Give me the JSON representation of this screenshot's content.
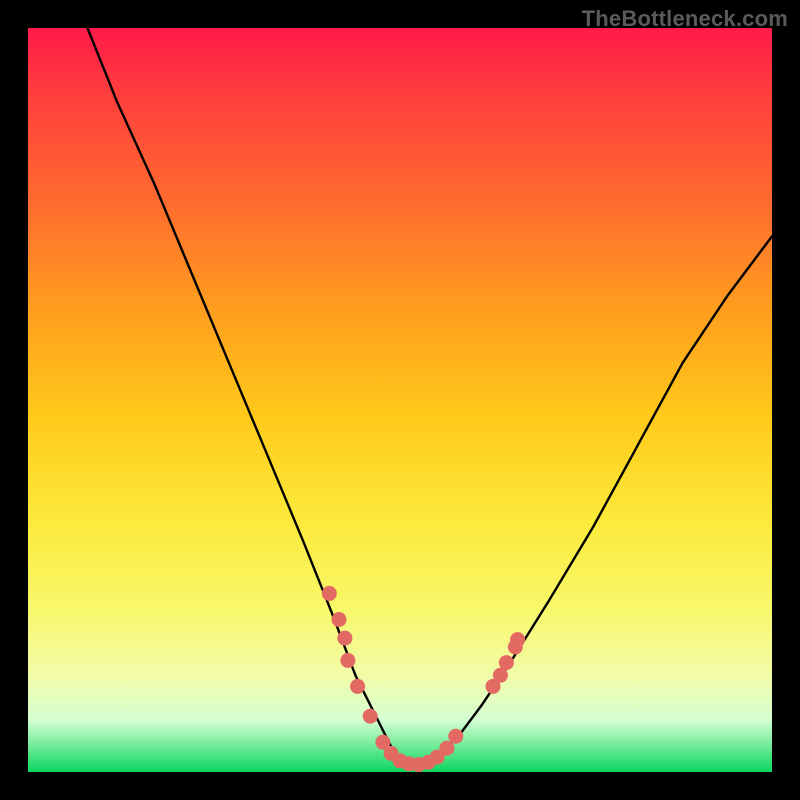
{
  "watermark": "TheBottleneck.com",
  "colors": {
    "frame_bg_top": "#ff1a4a",
    "frame_bg_bottom": "#0bd65f",
    "curve_stroke": "#000000",
    "marker_fill": "#e26a62",
    "page_bg": "#000000",
    "watermark_color": "#5a5a5a"
  },
  "chart_data": {
    "type": "line",
    "title": "",
    "xlabel": "",
    "ylabel": "",
    "xlim": [
      0,
      100
    ],
    "ylim": [
      0,
      100
    ],
    "grid": false,
    "legend": false,
    "series": [
      {
        "name": "curve",
        "x": [
          8,
          12,
          17,
          22,
          27,
          32,
          37,
          41,
          44,
          47,
          49,
          51,
          53,
          55,
          58,
          61,
          65,
          70,
          76,
          82,
          88,
          94,
          100
        ],
        "y": [
          100,
          90,
          79,
          67,
          55,
          43,
          31,
          21,
          13,
          7,
          3,
          1,
          1,
          2,
          5,
          9,
          15,
          23,
          33,
          44,
          55,
          64,
          72
        ]
      }
    ],
    "markers": [
      {
        "x": 40.5,
        "y": 24.0
      },
      {
        "x": 41.8,
        "y": 20.5
      },
      {
        "x": 42.6,
        "y": 18.0
      },
      {
        "x": 43.0,
        "y": 15.0
      },
      {
        "x": 44.3,
        "y": 11.5
      },
      {
        "x": 46.0,
        "y": 7.5
      },
      {
        "x": 47.7,
        "y": 4.0
      },
      {
        "x": 48.8,
        "y": 2.5
      },
      {
        "x": 50.0,
        "y": 1.5
      },
      {
        "x": 51.2,
        "y": 1.1
      },
      {
        "x": 52.5,
        "y": 1.0
      },
      {
        "x": 53.8,
        "y": 1.3
      },
      {
        "x": 55.0,
        "y": 2.0
      },
      {
        "x": 56.3,
        "y": 3.2
      },
      {
        "x": 57.5,
        "y": 4.8
      },
      {
        "x": 62.5,
        "y": 11.5
      },
      {
        "x": 63.5,
        "y": 13.0
      },
      {
        "x": 64.3,
        "y": 14.7
      },
      {
        "x": 65.5,
        "y": 16.8
      },
      {
        "x": 65.8,
        "y": 17.8
      }
    ]
  }
}
